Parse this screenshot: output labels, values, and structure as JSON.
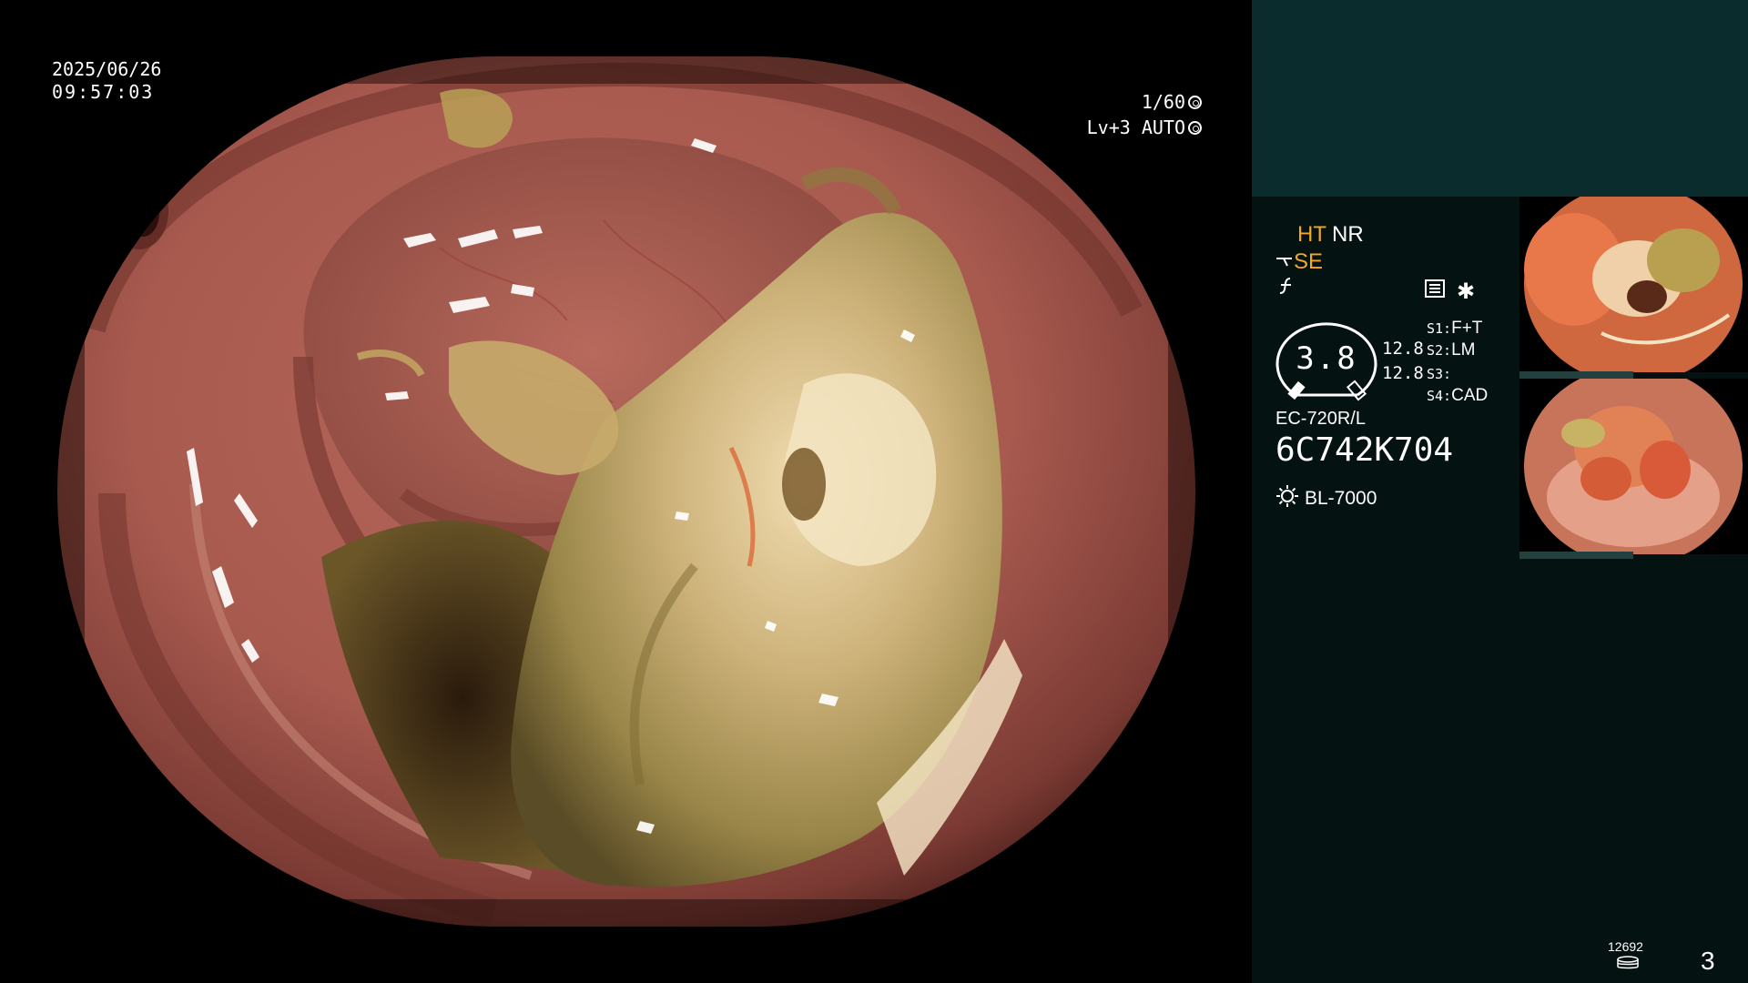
{
  "overlay": {
    "date": "2025/06/26",
    "time": "09:57:03",
    "shutter": "1/60",
    "level": "Lv+3 AUTO"
  },
  "panel": {
    "mode_ht": "HT",
    "mode_nr": "NR",
    "se_label": "SE",
    "fn_label": "⌐",
    "zoom_value": "3.8",
    "zoom_a": "12.8",
    "zoom_b": "12.8",
    "switches": [
      {
        "key": "S1:",
        "value": "F+T"
      },
      {
        "key": "S2:",
        "value": "LM"
      },
      {
        "key": "S3:",
        "value": ""
      },
      {
        "key": "S4:",
        "value": "CAD"
      }
    ],
    "scope_model": "EC-720R/L",
    "scope_serial": "6C742K704",
    "light_source": "BL-7000",
    "star": "✱",
    "counter": "12692",
    "page_number": "3"
  },
  "colors": {
    "panel_bg": "#041211",
    "panel_top_bg": "#0a2c2c",
    "accent": "#f5a623",
    "thumb_strip": "#23403f"
  },
  "icons": {
    "shutter": "aperture-icon",
    "level": "target-icon",
    "se": "wire-icon",
    "fn": "function-icon",
    "grid": "grid-icon",
    "star": "star-icon",
    "light": "sun-icon",
    "counter": "database-icon"
  }
}
